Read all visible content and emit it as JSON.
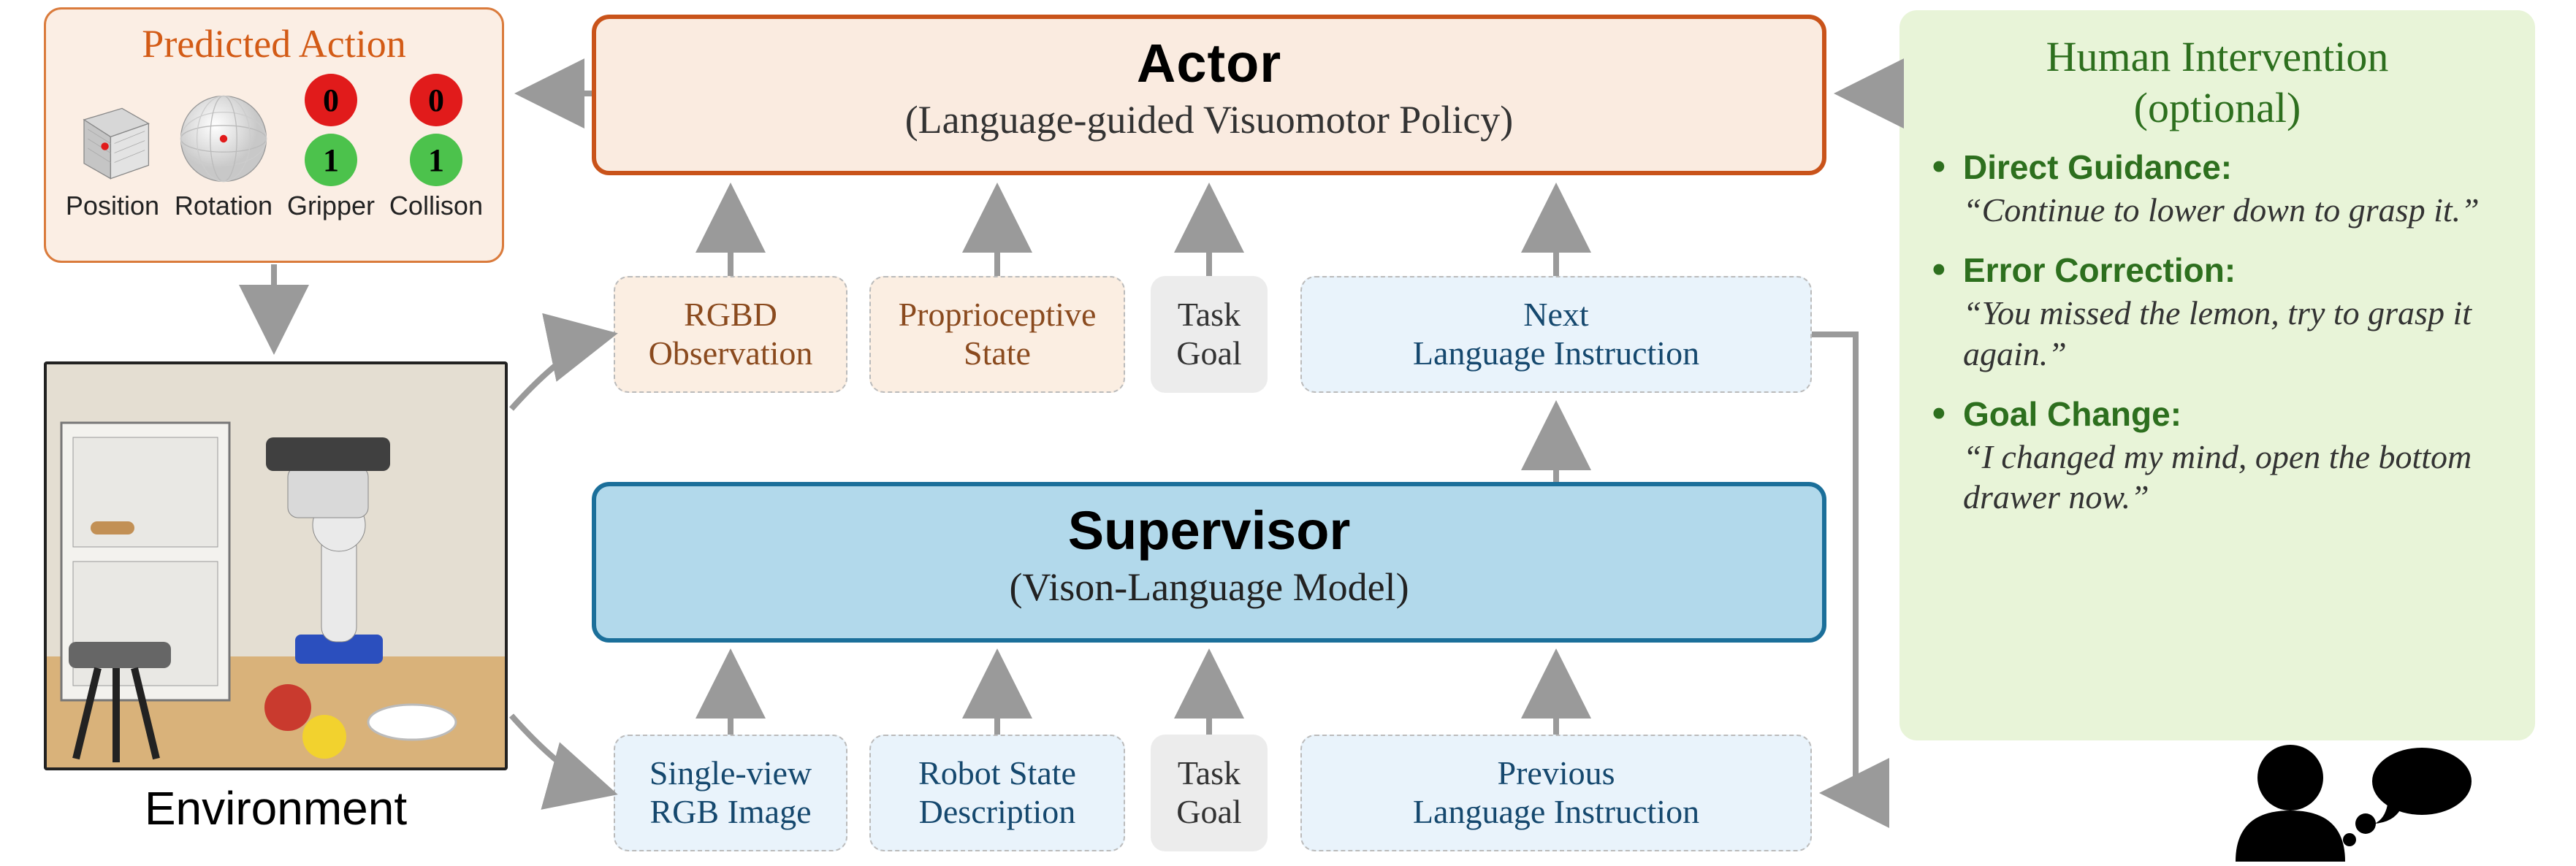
{
  "predicted_action": {
    "title": "Predicted Action",
    "cells": {
      "position": "Position",
      "rotation": "Rotation",
      "gripper": "Gripper",
      "collision": "Collison"
    },
    "badges": {
      "gripper_top": "0",
      "gripper_bottom": "1",
      "collision_top": "0",
      "collision_bottom": "1"
    }
  },
  "environment": {
    "label": "Environment"
  },
  "actor": {
    "title": "Actor",
    "subtitle": "(Language-guided Visuomotor Policy)"
  },
  "supervisor": {
    "title": "Supervisor",
    "subtitle": "(Vison-Language Model)"
  },
  "actor_inputs": {
    "rgbd": "RGBD\nObservation",
    "proprio": "Proprioceptive\nState",
    "task_goal": "Task\nGoal",
    "next_instr": "Next\nLanguage Instruction"
  },
  "supervisor_inputs": {
    "single_view": "Single-view\nRGB Image",
    "robot_state": "Robot State\nDescription",
    "task_goal": "Task\nGoal",
    "prev_instr": "Previous\nLanguage Instruction"
  },
  "human": {
    "title": "Human Intervention\n(optional)",
    "items": [
      {
        "head": "Direct Guidance:",
        "body": "“Continue to lower down to grasp it.”"
      },
      {
        "head": "Error Correction:",
        "body": "“You missed the lemon, try to grasp it again.”"
      },
      {
        "head": "Goal Change:",
        "body": "“I changed my mind, open the bottom drawer now.”"
      }
    ]
  }
}
